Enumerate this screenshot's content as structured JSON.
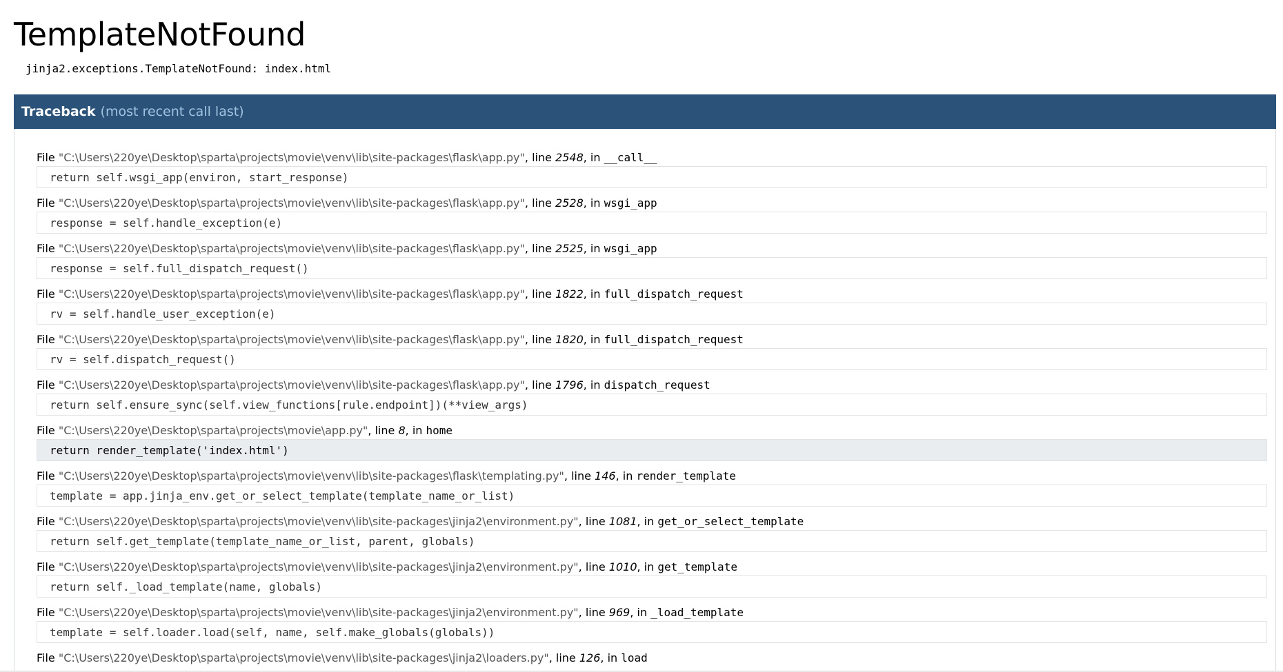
{
  "error": {
    "title": "TemplateNotFound",
    "message": "jinja2.exceptions.TemplateNotFound: index.html"
  },
  "traceback": {
    "title": "Traceback",
    "subtitle": "(most recent call last)",
    "labels": {
      "file": "File",
      "line": "line",
      "in": "in"
    },
    "frames": [
      {
        "file": "\"C:\\Users\\220ye\\Desktop\\sparta\\projects\\movie\\venv\\lib\\site-packages\\flask\\app.py\"",
        "line": "2548",
        "func": "__call__",
        "source": "return self.wsgi_app(environ, start_response)"
      },
      {
        "file": "\"C:\\Users\\220ye\\Desktop\\sparta\\projects\\movie\\venv\\lib\\site-packages\\flask\\app.py\"",
        "line": "2528",
        "func": "wsgi_app",
        "source": "response = self.handle_exception(e)"
      },
      {
        "file": "\"C:\\Users\\220ye\\Desktop\\sparta\\projects\\movie\\venv\\lib\\site-packages\\flask\\app.py\"",
        "line": "2525",
        "func": "wsgi_app",
        "source": "response = self.full_dispatch_request()"
      },
      {
        "file": "\"C:\\Users\\220ye\\Desktop\\sparta\\projects\\movie\\venv\\lib\\site-packages\\flask\\app.py\"",
        "line": "1822",
        "func": "full_dispatch_request",
        "source": "rv = self.handle_user_exception(e)"
      },
      {
        "file": "\"C:\\Users\\220ye\\Desktop\\sparta\\projects\\movie\\venv\\lib\\site-packages\\flask\\app.py\"",
        "line": "1820",
        "func": "full_dispatch_request",
        "source": "rv = self.dispatch_request()"
      },
      {
        "file": "\"C:\\Users\\220ye\\Desktop\\sparta\\projects\\movie\\venv\\lib\\site-packages\\flask\\app.py\"",
        "line": "1796",
        "func": "dispatch_request",
        "source": "return self.ensure_sync(self.view_functions[rule.endpoint])(**view_args)"
      },
      {
        "file": "\"C:\\Users\\220ye\\Desktop\\sparta\\projects\\movie\\app.py\"",
        "line": "8",
        "func": "home",
        "source": "return render_template('index.html')",
        "current": true
      },
      {
        "file": "\"C:\\Users\\220ye\\Desktop\\sparta\\projects\\movie\\venv\\lib\\site-packages\\flask\\templating.py\"",
        "line": "146",
        "func": "render_template",
        "source": "template = app.jinja_env.get_or_select_template(template_name_or_list)"
      },
      {
        "file": "\"C:\\Users\\220ye\\Desktop\\sparta\\projects\\movie\\venv\\lib\\site-packages\\jinja2\\environment.py\"",
        "line": "1081",
        "func": "get_or_select_template",
        "source": "return self.get_template(template_name_or_list, parent, globals)"
      },
      {
        "file": "\"C:\\Users\\220ye\\Desktop\\sparta\\projects\\movie\\venv\\lib\\site-packages\\jinja2\\environment.py\"",
        "line": "1010",
        "func": "get_template",
        "source": "return self._load_template(name, globals)"
      },
      {
        "file": "\"C:\\Users\\220ye\\Desktop\\sparta\\projects\\movie\\venv\\lib\\site-packages\\jinja2\\environment.py\"",
        "line": "969",
        "func": "_load_template",
        "source": "template = self.loader.load(self, name, self.make_globals(globals))"
      },
      {
        "file": "\"C:\\Users\\220ye\\Desktop\\sparta\\projects\\movie\\venv\\lib\\site-packages\\jinja2\\loaders.py\"",
        "line": "126",
        "func": "load",
        "source": ""
      }
    ]
  },
  "colors": {
    "header_bg": "#2b5379",
    "header_subtitle": "#9fc3e0",
    "current_frame_bg": "#e9edf0",
    "filename": "#555555"
  }
}
